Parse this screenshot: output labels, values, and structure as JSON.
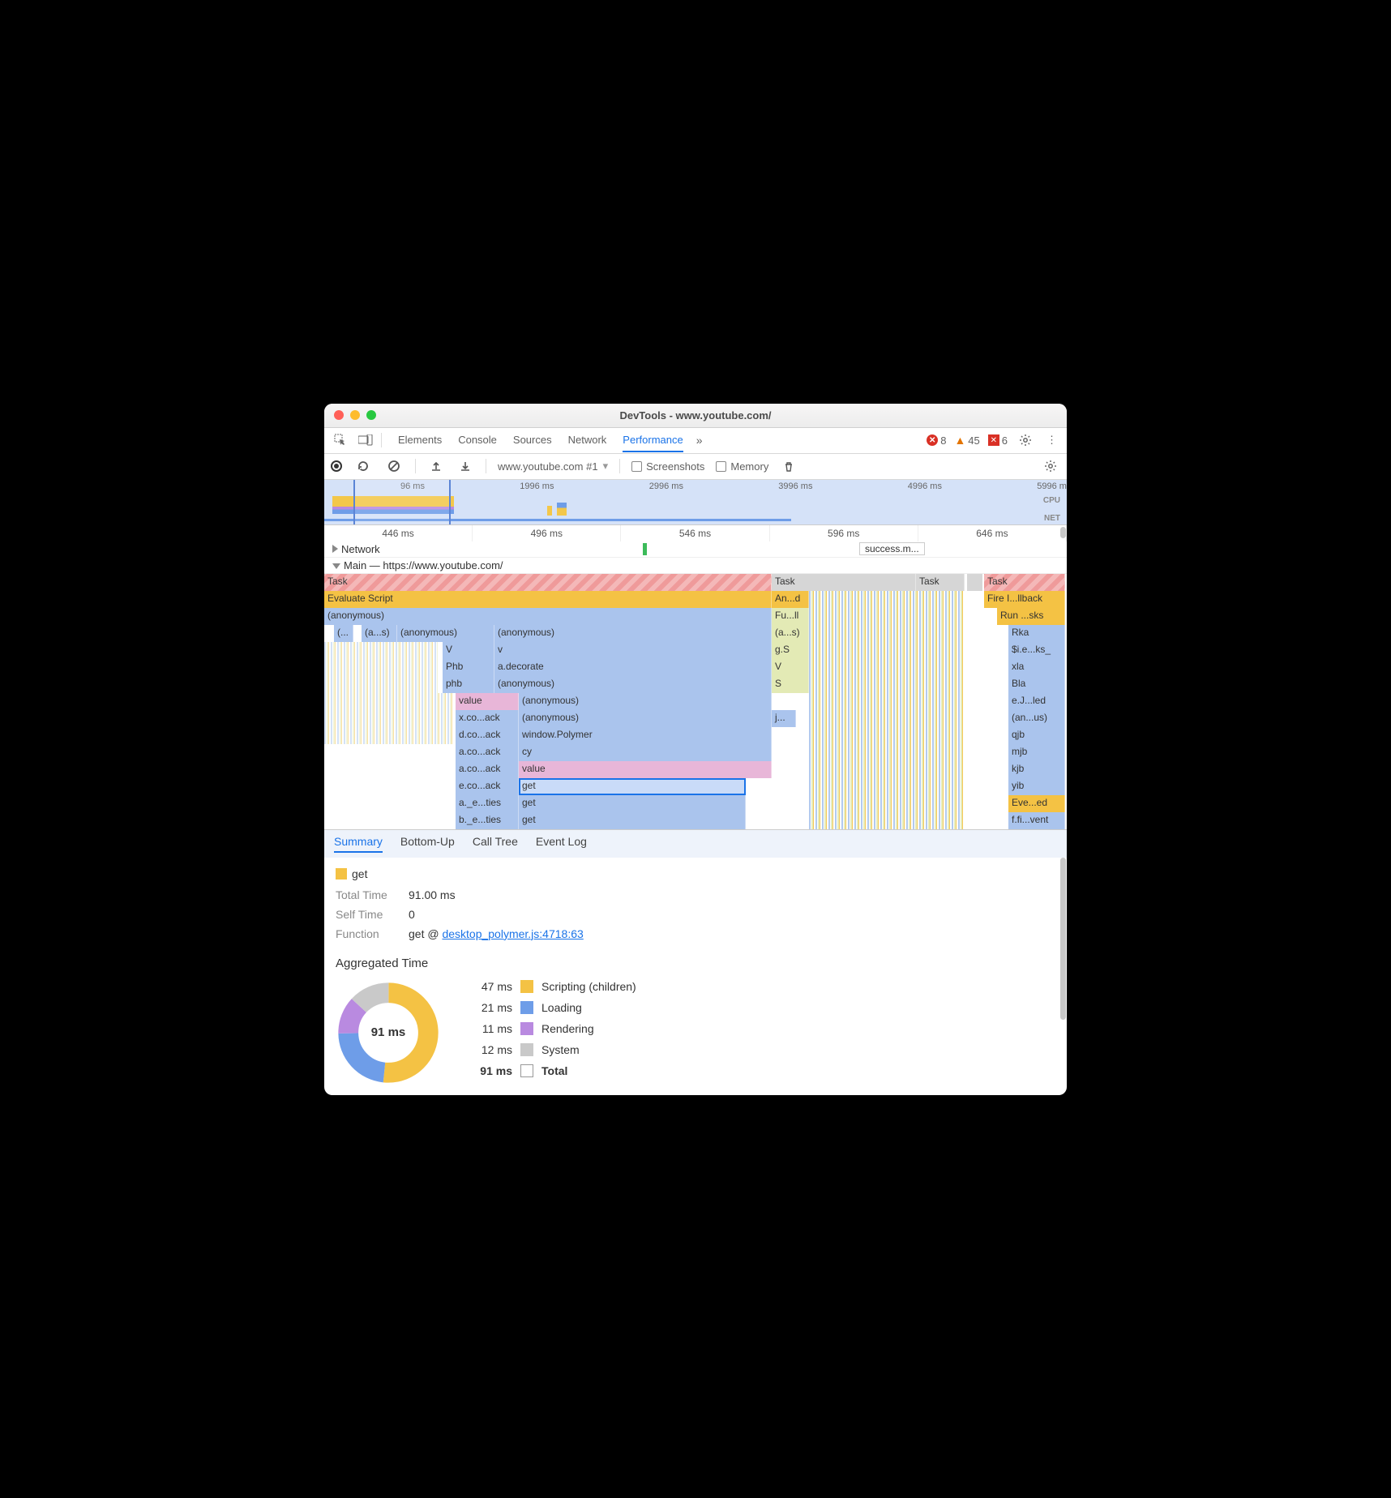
{
  "window": {
    "title": "DevTools - www.youtube.com/"
  },
  "top_tabs": {
    "items": [
      "Elements",
      "Console",
      "Sources",
      "Network",
      "Performance"
    ],
    "active": "Performance"
  },
  "errors": {
    "error_count": "8",
    "warn_count": "45",
    "issue_count": "6"
  },
  "perf_toolbar": {
    "target": "www.youtube.com #1",
    "screenshots_label": "Screenshots",
    "memory_label": "Memory"
  },
  "overview_ticks": [
    "96 ms",
    "1996 ms",
    "2996 ms",
    "3996 ms",
    "4996 ms",
    "5996 m"
  ],
  "overview_labels": {
    "cpu": "CPU",
    "net": "NET"
  },
  "ruler_ticks": [
    "446 ms",
    "496 ms",
    "546 ms",
    "596 ms",
    "646 ms"
  ],
  "network_row": {
    "label": "Network",
    "pill": "success.m...",
    "mark_color": "#3cbb5a"
  },
  "main_row": {
    "label": "Main — https://www.youtube.com/"
  },
  "flame": {
    "col1": {
      "task": "Task",
      "eval": "Evaluate Script",
      "anon": "(anonymous)",
      "c1": "(...",
      "c2": "(a...s)",
      "c3": "(anonymous)",
      "c4": "(anonymous)",
      "r4a": "V",
      "r4b": "v",
      "r5a": "Phb",
      "r5b": "a.decorate",
      "r6a": "phb",
      "r6b": "(anonymous)",
      "r7a": "value",
      "r7b": "(anonymous)",
      "r8a": "x.co...ack",
      "r8b": "(anonymous)",
      "r9a": "d.co...ack",
      "r9b": "window.Polymer",
      "r10a": "a.co...ack",
      "r10b": "cy",
      "r11a": "a.co...ack",
      "r11b": "value",
      "r12a": "e.co...ack",
      "r12b": "get",
      "r13a": "a._e...ties",
      "r13b": "get",
      "r14a": "b._e...ties",
      "r14b": "get"
    },
    "col2": {
      "task": "Task",
      "anod": "An...d",
      "fuii": "Fu...ll",
      "as": "(a...s)",
      "gs": "g.S",
      "v": "V",
      "s": "S",
      "j": "j..."
    },
    "col3": {
      "task": "Task",
      "fire": "Fire I...llback",
      "run": "Run ...sks",
      "r": [
        "Rka",
        "$i.e...ks_",
        "xla",
        "Bla",
        "e.J...led",
        "(an...us)",
        "qjb",
        "mjb",
        "kjb",
        "yib",
        "Eve...ed",
        "f.fi...vent"
      ]
    }
  },
  "bottom_tabs": {
    "items": [
      "Summary",
      "Bottom-Up",
      "Call Tree",
      "Event Log"
    ],
    "active": "Summary"
  },
  "summary": {
    "name": "get",
    "total_label": "Total Time",
    "total_val": "91.00 ms",
    "self_label": "Self Time",
    "self_val": "0",
    "func_label": "Function",
    "func_prefix": "get @ ",
    "func_link": "desktop_polymer.js:4718:63",
    "agg_title": "Aggregated Time",
    "donut_center": "91 ms",
    "legend": [
      {
        "t": "47 ms",
        "c": "#f4c244",
        "n": "Scripting (children)"
      },
      {
        "t": "21 ms",
        "c": "#6e9de8",
        "n": "Loading"
      },
      {
        "t": "11 ms",
        "c": "#b98ae0",
        "n": "Rendering"
      },
      {
        "t": "12 ms",
        "c": "#c9c9c9",
        "n": "System"
      },
      {
        "t": "91 ms",
        "c": "#ffffff",
        "n": "Total",
        "bold": true,
        "border": true
      }
    ]
  },
  "chart_data": {
    "type": "pie",
    "title": "Aggregated Time",
    "categories": [
      "Scripting (children)",
      "Loading",
      "Rendering",
      "System"
    ],
    "values": [
      47,
      21,
      11,
      12
    ],
    "total": 91,
    "unit": "ms"
  }
}
